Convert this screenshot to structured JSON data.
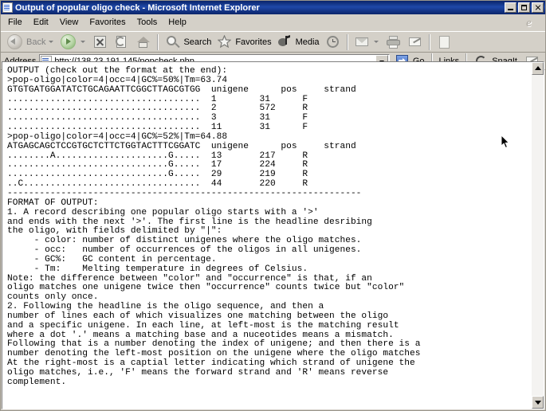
{
  "window": {
    "title": "Output of popular oligo check - Microsoft Internet Explorer",
    "icon": "ie-page-icon",
    "minimize_label": "Minimize",
    "maximize_label": "Maximize",
    "close_label": "Close"
  },
  "menu": {
    "items": [
      {
        "label": "File"
      },
      {
        "label": "Edit"
      },
      {
        "label": "View"
      },
      {
        "label": "Favorites"
      },
      {
        "label": "Tools"
      },
      {
        "label": "Help"
      }
    ],
    "brand_glyph": "e"
  },
  "toolbar": {
    "back_label": "Back",
    "forward_label": "",
    "stop_label": "",
    "refresh_label": "",
    "home_label": "",
    "search_label": "Search",
    "favorites_label": "Favorites",
    "media_label": "Media",
    "history_label": "",
    "mail_label": "",
    "print_label": "",
    "edit_label": "",
    "discuss_label": ""
  },
  "address": {
    "label": "Address",
    "url": "http://138.23.191.145/popcheck.php",
    "placeholder": "",
    "go_label": "Go",
    "links_label": "Links",
    "snagit_label": "SnagIt"
  },
  "content": {
    "text": "OUTPUT (check out the format at the end):\n>pop-oligo|color=4|occ=4|GC%=50%|Tm=63.74\nGTGTGATGGATATCTGCAGAATTCGGCTTAGCGTGG  unigene      pos     strand\n....................................  1        31      F\n....................................  2        572     R\n....................................  3        31      F\n....................................  11       31      F\n>pop-oligo|color=4|occ=4|GC%=52%|Tm=64.88\nATGAGCAGCTCCGTGCTCTTCTGGTACTTTCGGATC  unigene      pos     strand\n........A.....................G.....  13       217     R\n..............................G.....  17       224     R\n..............................G.....  29       219     R\n..C.................................  44       220     R\n------------------------------------------------------------------\nFORMAT OF OUTPUT:\n1. A record describing one popular oligo starts with a '>'\nand ends with the next '>'. The first line is the headline desribing\nthe oligo, with fields delimited by \"|\":\n     - color: number of distinct unigenes where the oligo matches.\n     - occ:   number of occurrences of the oligos in all unigenes.\n     - GC%:   GC content in percentage.\n     - Tm:    Melting temperature in degrees of Celsius.\nNote: the difference between \"color\" and \"occurrence\" is that, if an\noligo matches one unigene twice then \"occurrence\" counts twice but \"color\"\ncounts only once.\n2. Following the headline is the oligo sequence, and then a\nnumber of lines each of which visualizes one matching between the oligo\nand a specific unigene. In each line, at left-most is the matching result\nwhere a dot '.' means a matching base and a nuceotides means a mismatch.\nFollowing that is a number denoting the index of unigene; and then there is a\nnumber denoting the left-most position on the unigene where the oligo matches\nAt the right-most is a captial letter indicating which strand of unigene the\noligo matches, i.e., 'F' means the forward strand and 'R' means reverse\ncomplement."
  },
  "records": [
    {
      "headline": ">pop-oligo|color=4|occ=4|GC%=50%|Tm=63.74",
      "sequence": "GTGTGATGGATATCTGCAGAATTCGGCTTAGCGTGG",
      "columns": [
        "unigene",
        "pos",
        "strand"
      ],
      "color": 4,
      "occ": 4,
      "gc_percent": "50%",
      "tm": 63.74,
      "matches": [
        {
          "align": "....................................",
          "unigene": 1,
          "pos": 31,
          "strand": "F"
        },
        {
          "align": "....................................",
          "unigene": 2,
          "pos": 572,
          "strand": "R"
        },
        {
          "align": "....................................",
          "unigene": 3,
          "pos": 31,
          "strand": "F"
        },
        {
          "align": "....................................",
          "unigene": 11,
          "pos": 31,
          "strand": "F"
        }
      ]
    },
    {
      "headline": ">pop-oligo|color=4|occ=4|GC%=52%|Tm=64.88",
      "sequence": "ATGAGCAGCTCCGTGCTCTTCTGGTACTTTCGGATC",
      "columns": [
        "unigene",
        "pos",
        "strand"
      ],
      "color": 4,
      "occ": 4,
      "gc_percent": "52%",
      "tm": 64.88,
      "matches": [
        {
          "align": "........A.....................G.....",
          "unigene": 13,
          "pos": 217,
          "strand": "R"
        },
        {
          "align": "..............................G.....",
          "unigene": 17,
          "pos": 224,
          "strand": "R"
        },
        {
          "align": "..............................G.....",
          "unigene": 29,
          "pos": 219,
          "strand": "R"
        },
        {
          "align": "..C.................................",
          "unigene": 44,
          "pos": 220,
          "strand": "R"
        }
      ]
    }
  ],
  "scrollbar": {
    "up_label": "Scroll up",
    "down_label": "Scroll down"
  },
  "colors": {
    "titlebar_start": "#0a246a",
    "titlebar_end": "#1f48a8",
    "chrome": "#d4d0c8",
    "page_bg": "#ffffff",
    "text": "#000000",
    "disabled_text": "#808080"
  }
}
